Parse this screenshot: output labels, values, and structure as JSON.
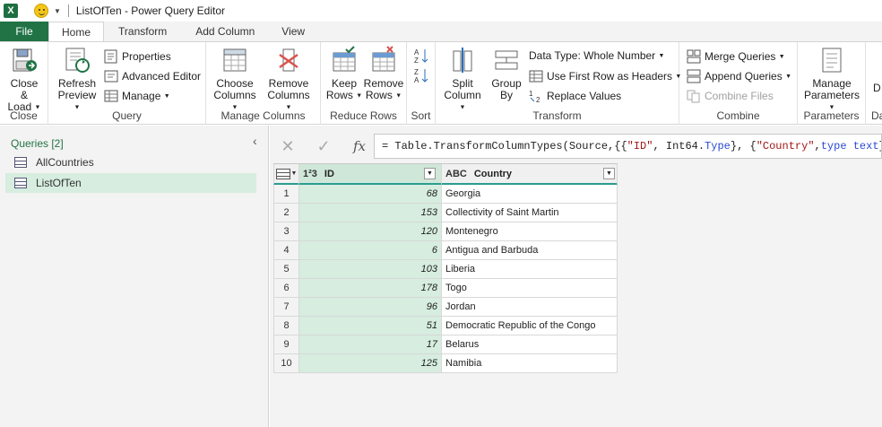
{
  "window": {
    "title": "ListOfTen - Power Query Editor",
    "app_logo": "X"
  },
  "tabs": [
    "File",
    "Home",
    "Transform",
    "Add Column",
    "View"
  ],
  "ribbon": {
    "close": {
      "btn1": "Close &",
      "btn2": "Load",
      "label": "Close"
    },
    "query": {
      "refresh1": "Refresh",
      "refresh2": "Preview",
      "properties": "Properties",
      "advanced": "Advanced Editor",
      "manage": "Manage",
      "label": "Query"
    },
    "manage_cols": {
      "choose1": "Choose",
      "choose2": "Columns",
      "remove1": "Remove",
      "remove2": "Columns",
      "label": "Manage Columns"
    },
    "reduce_rows": {
      "keep1": "Keep",
      "keep2": "Rows",
      "remove1": "Remove",
      "remove2": "Rows",
      "label": "Reduce Rows"
    },
    "sort": {
      "label": "Sort"
    },
    "transform": {
      "split1": "Split",
      "split2": "Column",
      "group1": "Group",
      "group2": "By",
      "datatype": "Data Type: Whole Number",
      "firstrow": "Use First Row as Headers",
      "replace": "Replace Values",
      "label": "Transform"
    },
    "combine": {
      "merge": "Merge Queries",
      "append": "Append Queries",
      "files": "Combine Files",
      "label": "Combine"
    },
    "parameters": {
      "manage1": "Manage",
      "manage2": "Parameters",
      "label": "Parameters"
    },
    "datasource": {
      "btn": "D",
      "label": "Da"
    }
  },
  "queries": {
    "header": "Queries [2]",
    "items": [
      "AllCountries",
      "ListOfTen"
    ]
  },
  "formula": {
    "fx": "fx",
    "prefix": "= Table.TransformColumnTypes(Source,{{",
    "s1": "\"ID\"",
    "mid1": ", Int64.",
    "kw1": "Type",
    "mid2": "}, {",
    "s2": "\"Country\"",
    "mid3": ", ",
    "kw2": "type text",
    "suffix": "}})"
  },
  "table": {
    "columns": [
      {
        "type_icon": "1²3",
        "name": "ID"
      },
      {
        "type_icon": "ABC",
        "name": "Country"
      }
    ],
    "rows": [
      {
        "n": "1",
        "id": "68",
        "country": "Georgia"
      },
      {
        "n": "2",
        "id": "153",
        "country": "Collectivity of Saint Martin"
      },
      {
        "n": "3",
        "id": "120",
        "country": "Montenegro"
      },
      {
        "n": "4",
        "id": "6",
        "country": "Antigua and Barbuda"
      },
      {
        "n": "5",
        "id": "103",
        "country": "Liberia"
      },
      {
        "n": "6",
        "id": "178",
        "country": "Togo"
      },
      {
        "n": "7",
        "id": "96",
        "country": "Jordan"
      },
      {
        "n": "8",
        "id": "51",
        "country": "Democratic Republic of the Congo"
      },
      {
        "n": "9",
        "id": "17",
        "country": "Belarus"
      },
      {
        "n": "10",
        "id": "125",
        "country": "Namibia"
      }
    ]
  },
  "colors": {
    "accent": "#217346",
    "selected": "#d6eddf",
    "header_underline": "#2a9d8f"
  }
}
